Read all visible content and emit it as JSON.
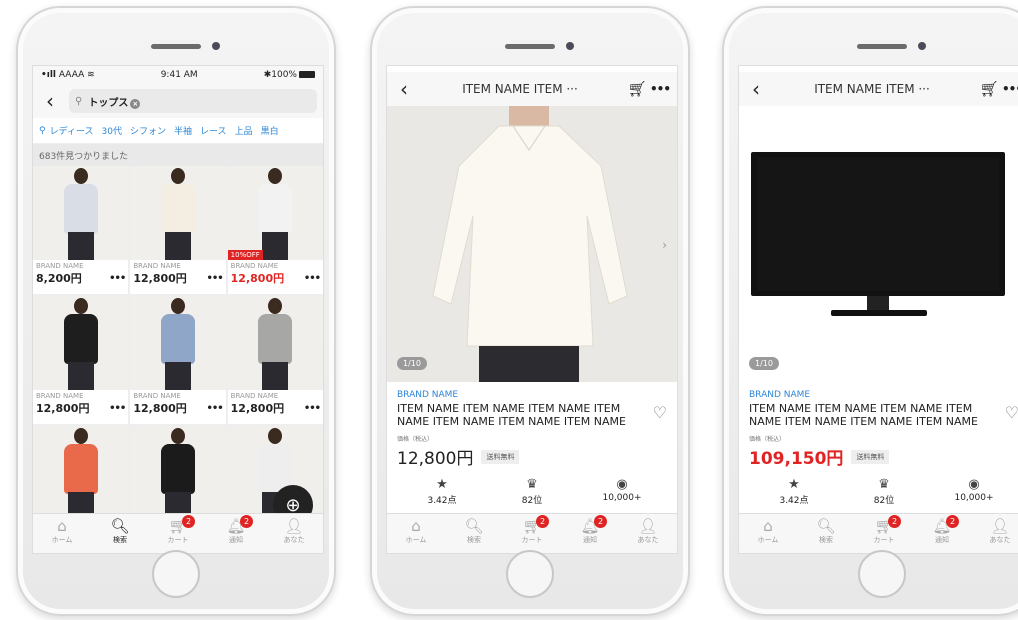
{
  "colors": {
    "accent": "#2d86d6",
    "sale_red": "#e02424"
  },
  "tabbar": [
    {
      "icon": "home-icon",
      "glyph": "⌂",
      "label": "ホーム"
    },
    {
      "icon": "search-icon",
      "glyph": "🔍︎",
      "label": "検索"
    },
    {
      "icon": "cart-icon",
      "glyph": "🛒︎",
      "label": "カート",
      "badge": "2"
    },
    {
      "icon": "bell-icon",
      "glyph": "🔔︎",
      "label": "通知",
      "badge": "2"
    },
    {
      "icon": "user-icon",
      "glyph": "👤︎",
      "label": "あなた"
    }
  ],
  "search_screen": {
    "status": {
      "carrier": "AAAA",
      "time": "9:41 AM",
      "battery": "100%"
    },
    "search_chip": "トップス",
    "tags": [
      "レディース",
      "30代",
      "シフォン",
      "半袖",
      "レース",
      "上品",
      "黒白"
    ],
    "result_count": "683件見つかりました",
    "products": [
      {
        "brand": "BRAND NAME",
        "price": "8,200円",
        "color": "#d8dde6",
        "sale": false
      },
      {
        "brand": "BRAND NAME",
        "price": "12,800円",
        "color": "#f3ede2",
        "sale": false
      },
      {
        "brand": "BRAND NAME",
        "price": "12,800円",
        "color": "#f2f2f2",
        "sale": true,
        "badge": "10%OFF"
      },
      {
        "brand": "BRAND NAME",
        "price": "12,800円",
        "color": "#1e1e1e",
        "sale": false
      },
      {
        "brand": "BRAND NAME",
        "price": "12,800円",
        "color": "#8fa6c8",
        "sale": false
      },
      {
        "brand": "BRAND NAME",
        "price": "12,800円",
        "color": "#a7a7a5",
        "sale": false
      },
      {
        "color": "#e86a4a"
      },
      {
        "color": "#1b1b1b"
      },
      {
        "color": "#eeeeee"
      }
    ]
  },
  "item1": {
    "title": "ITEM NAME ITEM ···",
    "image_counter": "1/10",
    "brand": "BRAND NAME",
    "name": "ITEM NAME ITEM NAME ITEM NAME ITEM NAME ITEM NAME ITEM NAME ITEM NAME",
    "price_label": "価格（税込）",
    "price": "12,800円",
    "shipping": "送料無料",
    "stats": [
      {
        "icon": "star-icon",
        "glyph": "★",
        "value": "3.42点"
      },
      {
        "icon": "crown-icon",
        "glyph": "♛",
        "value": "82位"
      },
      {
        "icon": "eye-icon",
        "glyph": "◉",
        "value": "10,000+"
      }
    ]
  },
  "item2": {
    "title": "ITEM NAME ITEM ···",
    "image_counter": "1/10",
    "brand": "BRAND NAME",
    "name": "ITEM NAME ITEM NAME ITEM NAME ITEM NAME ITEM NAME ITEM NAME ITEM NAME",
    "price_label": "価格（税込）",
    "price": "109,150円",
    "shipping": "送料無料",
    "stats": [
      {
        "icon": "star-icon",
        "glyph": "★",
        "value": "3.42点"
      },
      {
        "icon": "crown-icon",
        "glyph": "♛",
        "value": "82位"
      },
      {
        "icon": "eye-icon",
        "glyph": "◉",
        "value": "10,000+"
      }
    ]
  }
}
